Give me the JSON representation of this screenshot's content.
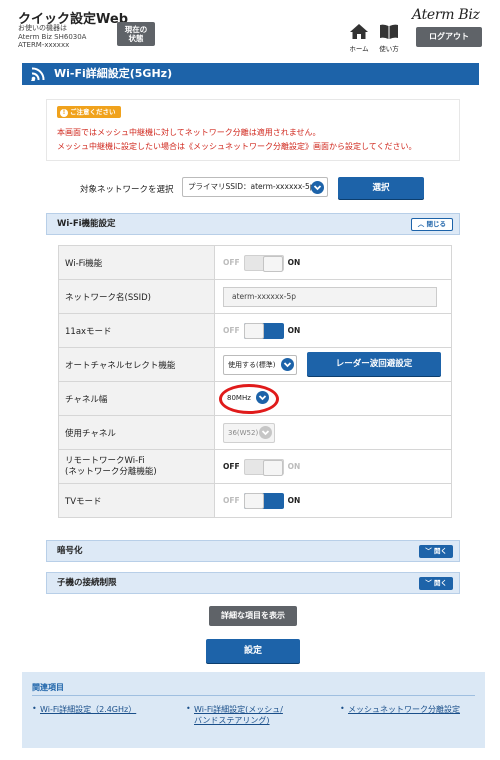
{
  "header": {
    "app_title": "クイック設定Web",
    "device_lines": [
      "お使いの機器は",
      "Aterm Biz SH6030A",
      "ATERM-xxxxxx"
    ],
    "status_button": [
      "現在の",
      "状態"
    ],
    "brand": "Aterm Biz",
    "home_label": "ホーム",
    "help_label": "使い方",
    "logout_label": "ログアウト"
  },
  "page_title": "Wi-Fi詳細設定(5GHz)",
  "notice": {
    "badge": "ご注意ください",
    "lines": [
      "本画面ではメッシュ中継機に対してネットワーク分離は適用されません。",
      "メッシュ中継機に設定したい場合は《メッシュネットワーク分離設定》画面から設定してください。"
    ]
  },
  "network_select": {
    "label": "対象ネットワークを選択",
    "value": "プライマリSSID：aterm-xxxxxx-5p",
    "button": "選択"
  },
  "wifi_section": {
    "title": "Wi-Fi機能設定",
    "toggle_label": "閉じる",
    "rows": [
      {
        "label": "Wi-Fi機能",
        "off": "OFF",
        "on": "ON",
        "state": "disabled"
      },
      {
        "label": "ネットワーク名(SSID)",
        "value": "aterm-xxxxxx-5p"
      },
      {
        "label": "11axモード",
        "off": "OFF",
        "on": "ON",
        "state": "on"
      },
      {
        "label": "オートチャネルセレクト機能",
        "select": "使用する(標準)",
        "button": "レーダー波回避設定"
      },
      {
        "label": "チャネル幅",
        "select": "80MHz"
      },
      {
        "label": "使用チャネル",
        "select": "36(W52)"
      },
      {
        "label": "リモートワークWi-Fi",
        "label2": "(ネットワーク分離機能)",
        "off": "OFF",
        "on": "ON",
        "state": "off"
      },
      {
        "label": "TVモード",
        "off": "OFF",
        "on": "ON",
        "state": "on"
      }
    ]
  },
  "encryption_section": {
    "title": "暗号化",
    "toggle_label": "開く"
  },
  "client_limit_section": {
    "title": "子機の接続制限",
    "toggle_label": "開く"
  },
  "buttons": {
    "detail": "詳細な項目を表示",
    "submit": "設定"
  },
  "related": {
    "title": "関連項目",
    "links": [
      {
        "bullet": "•",
        "text": "Wi-Fi詳細設定（2.4GHz）"
      },
      {
        "bullet": "•",
        "text": "Wi-Fi詳細設定(メッシュ/",
        "text2": "バンドステアリング)"
      },
      {
        "bullet": "•",
        "text": "メッシュネットワーク分離設定"
      }
    ]
  },
  "colors": {
    "primary": "#1d63a9",
    "dark_button": "#5f6368",
    "notice_red": "#d0281e",
    "badge": "#f0a21c",
    "highlight_ring": "#e01b1b"
  }
}
